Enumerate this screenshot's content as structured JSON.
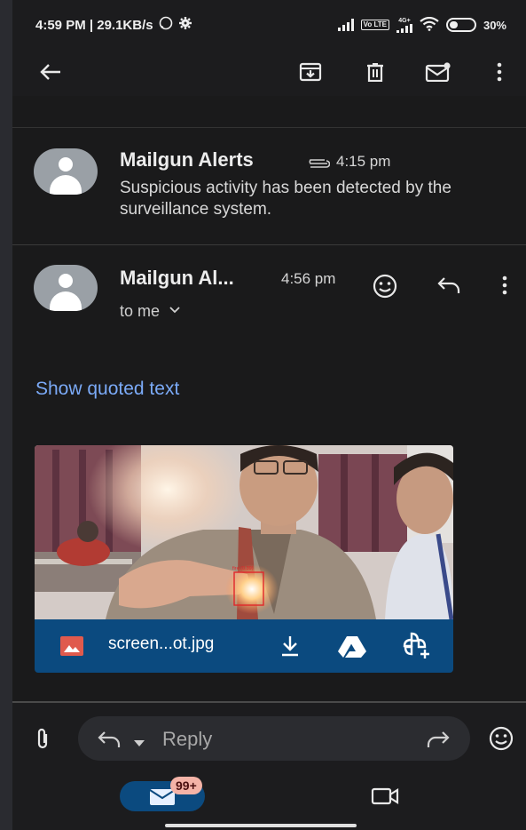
{
  "status_bar": {
    "time_speed": "4:59 PM | 29.1KB/s",
    "network_label": "4G+",
    "volte_label": "Vo LTE",
    "battery": "30%"
  },
  "thread": {
    "messages": [
      {
        "sender": "Mailgun Alerts",
        "time": "4:15 pm",
        "snippet": "Suspicious activity has been detected by the surveillance system.",
        "has_attachment_icon": true
      },
      {
        "sender": "Mailgun Al...",
        "time": "4:56 pm",
        "recipient": "to me",
        "show_quoted": "Show quoted text",
        "attachment": {
          "filename": "screen...ot.jpg",
          "detection_label": "fire (0.39)"
        }
      }
    ]
  },
  "reply_bar": {
    "reply_label": "Reply"
  },
  "bottom_nav": {
    "mail_badge": "99+"
  },
  "colors": {
    "accent_link": "#7baaf7",
    "attachment_bar": "#0b4a7f",
    "badge": "#f4b3a7"
  },
  "icons": {
    "toolbar": [
      "back-arrow-icon",
      "archive-icon",
      "delete-icon",
      "mark-unread-icon",
      "more-vert-icon"
    ],
    "message": [
      "emoji-react-icon",
      "reply-icon",
      "more-vert-icon"
    ],
    "attachment": [
      "image-file-icon",
      "download-icon",
      "drive-icon",
      "add-to-photos-icon"
    ],
    "reply_bar": [
      "attachment-clip-icon",
      "reply-icon",
      "dropdown-icon",
      "forward-icon",
      "emoji-icon"
    ],
    "nav": [
      "mail-icon",
      "video-icon"
    ]
  }
}
